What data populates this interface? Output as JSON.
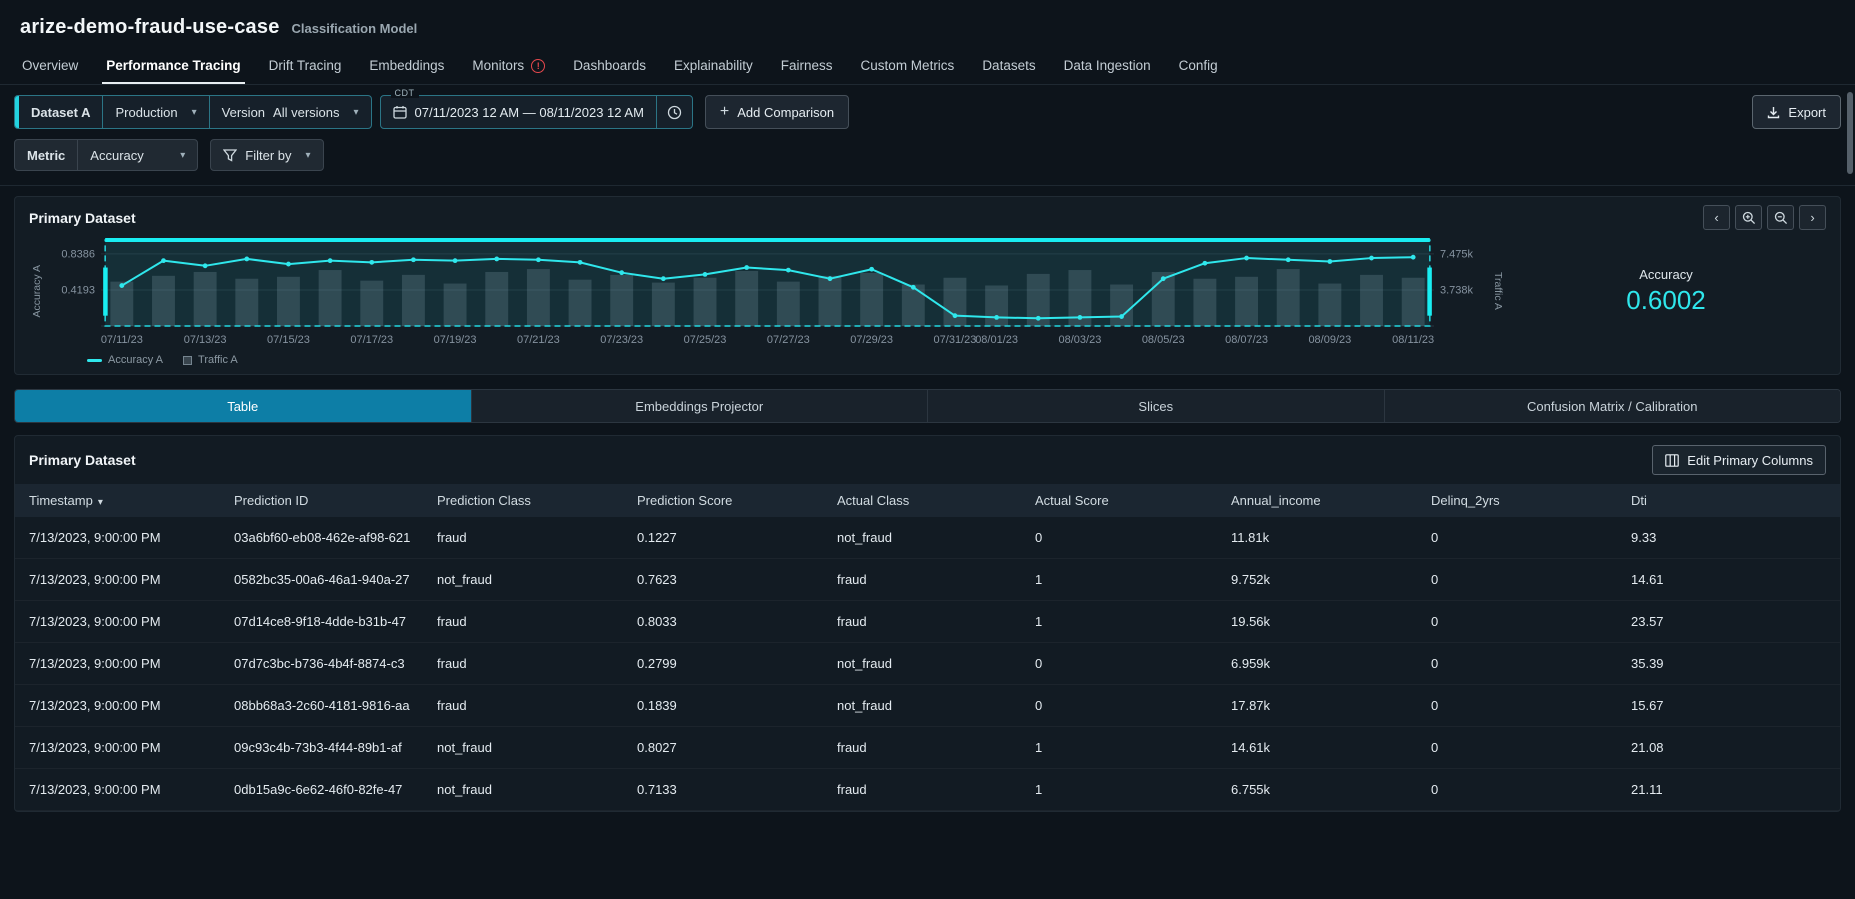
{
  "header": {
    "title": "arize-demo-fraud-use-case",
    "subtitle": "Classification Model"
  },
  "nav": {
    "tabs": [
      {
        "label": "Overview",
        "active": false,
        "alert": false
      },
      {
        "label": "Performance Tracing",
        "active": true,
        "alert": false
      },
      {
        "label": "Drift Tracing",
        "active": false,
        "alert": false
      },
      {
        "label": "Embeddings",
        "active": false,
        "alert": false
      },
      {
        "label": "Monitors",
        "active": false,
        "alert": true
      },
      {
        "label": "Dashboards",
        "active": false,
        "alert": false
      },
      {
        "label": "Explainability",
        "active": false,
        "alert": false
      },
      {
        "label": "Fairness",
        "active": false,
        "alert": false
      },
      {
        "label": "Custom Metrics",
        "active": false,
        "alert": false
      },
      {
        "label": "Datasets",
        "active": false,
        "alert": false
      },
      {
        "label": "Data Ingestion",
        "active": false,
        "alert": false
      },
      {
        "label": "Config",
        "active": false,
        "alert": false
      }
    ]
  },
  "toolbar": {
    "dataset_label": "Dataset A",
    "environment_value": "Production",
    "version_label": "Version",
    "version_value": "All versions",
    "timezone": "CDT",
    "date_range": "07/11/2023 12 AM  —  08/11/2023 12 AM",
    "add_comparison_label": "Add Comparison",
    "export_label": "Export",
    "metric_label": "Metric",
    "metric_value": "Accuracy",
    "filter_label": "Filter by"
  },
  "chart_panel": {
    "title": "Primary Dataset",
    "legend": [
      {
        "label": "Accuracy A",
        "marker": "line",
        "color": "#2fe7ec"
      },
      {
        "label": "Traffic A",
        "marker": "square",
        "color": "rgba(168,186,199,0.25)"
      }
    ],
    "metric_label": "Accuracy",
    "metric_value": "0.6002"
  },
  "chart_data": {
    "type": "line+bar",
    "title": "Primary Dataset",
    "x_days_count": 32,
    "x_ticks": [
      {
        "day": 0,
        "label": "07/11/23"
      },
      {
        "day": 2,
        "label": "07/13/23"
      },
      {
        "day": 4,
        "label": "07/15/23"
      },
      {
        "day": 6,
        "label": "07/17/23"
      },
      {
        "day": 8,
        "label": "07/19/23"
      },
      {
        "day": 10,
        "label": "07/21/23"
      },
      {
        "day": 12,
        "label": "07/23/23"
      },
      {
        "day": 14,
        "label": "07/25/23"
      },
      {
        "day": 16,
        "label": "07/27/23"
      },
      {
        "day": 18,
        "label": "07/29/23"
      },
      {
        "day": 20,
        "label": "07/31/23"
      },
      {
        "day": 21,
        "label": "08/01/23"
      },
      {
        "day": 23,
        "label": "08/03/23"
      },
      {
        "day": 25,
        "label": "08/05/23"
      },
      {
        "day": 27,
        "label": "08/07/23"
      },
      {
        "day": 29,
        "label": "08/09/23"
      },
      {
        "day": 31,
        "label": "08/11/23"
      }
    ],
    "left_axis": {
      "title": "Accuracy A",
      "tick_labels": [
        "0.8386",
        "0.4193"
      ],
      "tick_values": [
        0.8386,
        0.4193
      ],
      "max": 1.0
    },
    "right_axis": {
      "title": "Traffic A",
      "tick_labels": [
        "7.475k",
        "3.738k"
      ],
      "max_k": 8.913
    },
    "series": [
      {
        "name": "Accuracy A",
        "type": "line",
        "color": "#2fe7ec",
        "values": [
          0.47,
          0.76,
          0.7,
          0.78,
          0.72,
          0.76,
          0.74,
          0.77,
          0.76,
          0.78,
          0.77,
          0.74,
          0.62,
          0.55,
          0.6,
          0.68,
          0.65,
          0.55,
          0.66,
          0.45,
          0.12,
          0.1,
          0.09,
          0.1,
          0.11,
          0.55,
          0.73,
          0.79,
          0.77,
          0.75,
          0.79,
          0.8
        ]
      },
      {
        "name": "Traffic A",
        "type": "bar",
        "color": "rgba(168,186,199,0.20)",
        "values_k": [
          4.6,
          5.2,
          5.6,
          4.9,
          5.1,
          5.8,
          4.7,
          5.3,
          4.4,
          5.6,
          5.9,
          4.8,
          5.3,
          4.5,
          5.0,
          5.7,
          4.6,
          5.2,
          5.5,
          4.3,
          5.0,
          4.2,
          5.4,
          5.8,
          4.3,
          5.6,
          4.9,
          5.1,
          5.9,
          4.4,
          5.3,
          5.0
        ]
      }
    ],
    "selection": {
      "start_day": 0,
      "end_day": 31,
      "color": "#22d8e0"
    }
  },
  "view_tabs": [
    {
      "label": "Table",
      "active": true
    },
    {
      "label": "Embeddings Projector",
      "active": false
    },
    {
      "label": "Slices",
      "active": false
    },
    {
      "label": "Confusion Matrix / Calibration",
      "active": false
    }
  ],
  "table_panel": {
    "title": "Primary Dataset",
    "edit_columns_label": "Edit Primary Columns",
    "columns": [
      {
        "label": "Timestamp",
        "sort": "desc"
      },
      {
        "label": "Prediction ID"
      },
      {
        "label": "Prediction Class"
      },
      {
        "label": "Prediction Score"
      },
      {
        "label": "Actual Class"
      },
      {
        "label": "Actual Score"
      },
      {
        "label": "Annual_income"
      },
      {
        "label": "Delinq_2yrs"
      },
      {
        "label": "Dti"
      }
    ],
    "rows": [
      [
        "7/13/2023, 9:00:00 PM",
        "03a6bf60-eb08-462e-af98-621",
        "fraud",
        "0.1227",
        "not_fraud",
        "0",
        "11.81k",
        "0",
        "9.33"
      ],
      [
        "7/13/2023, 9:00:00 PM",
        "0582bc35-00a6-46a1-940a-27",
        "not_fraud",
        "0.7623",
        "fraud",
        "1",
        "9.752k",
        "0",
        "14.61"
      ],
      [
        "7/13/2023, 9:00:00 PM",
        "07d14ce8-9f18-4dde-b31b-47",
        "fraud",
        "0.8033",
        "fraud",
        "1",
        "19.56k",
        "0",
        "23.57"
      ],
      [
        "7/13/2023, 9:00:00 PM",
        "07d7c3bc-b736-4b4f-8874-c3",
        "fraud",
        "0.2799",
        "not_fraud",
        "0",
        "6.959k",
        "0",
        "35.39"
      ],
      [
        "7/13/2023, 9:00:00 PM",
        "08bb68a3-2c60-4181-9816-aa",
        "fraud",
        "0.1839",
        "not_fraud",
        "0",
        "17.87k",
        "0",
        "15.67"
      ],
      [
        "7/13/2023, 9:00:00 PM",
        "09c93c4b-73b3-4f44-89b1-af",
        "not_fraud",
        "0.8027",
        "fraud",
        "1",
        "14.61k",
        "0",
        "21.08"
      ],
      [
        "7/13/2023, 9:00:00 PM",
        "0db15a9c-6e62-46f0-82fe-47",
        "not_fraud",
        "0.7133",
        "fraud",
        "1",
        "6.755k",
        "0",
        "21.11"
      ]
    ]
  },
  "colors": {
    "accent_cyan": "#2fe7ec",
    "active_tab": "#0d7ea6",
    "alert_red": "#e5484d"
  }
}
